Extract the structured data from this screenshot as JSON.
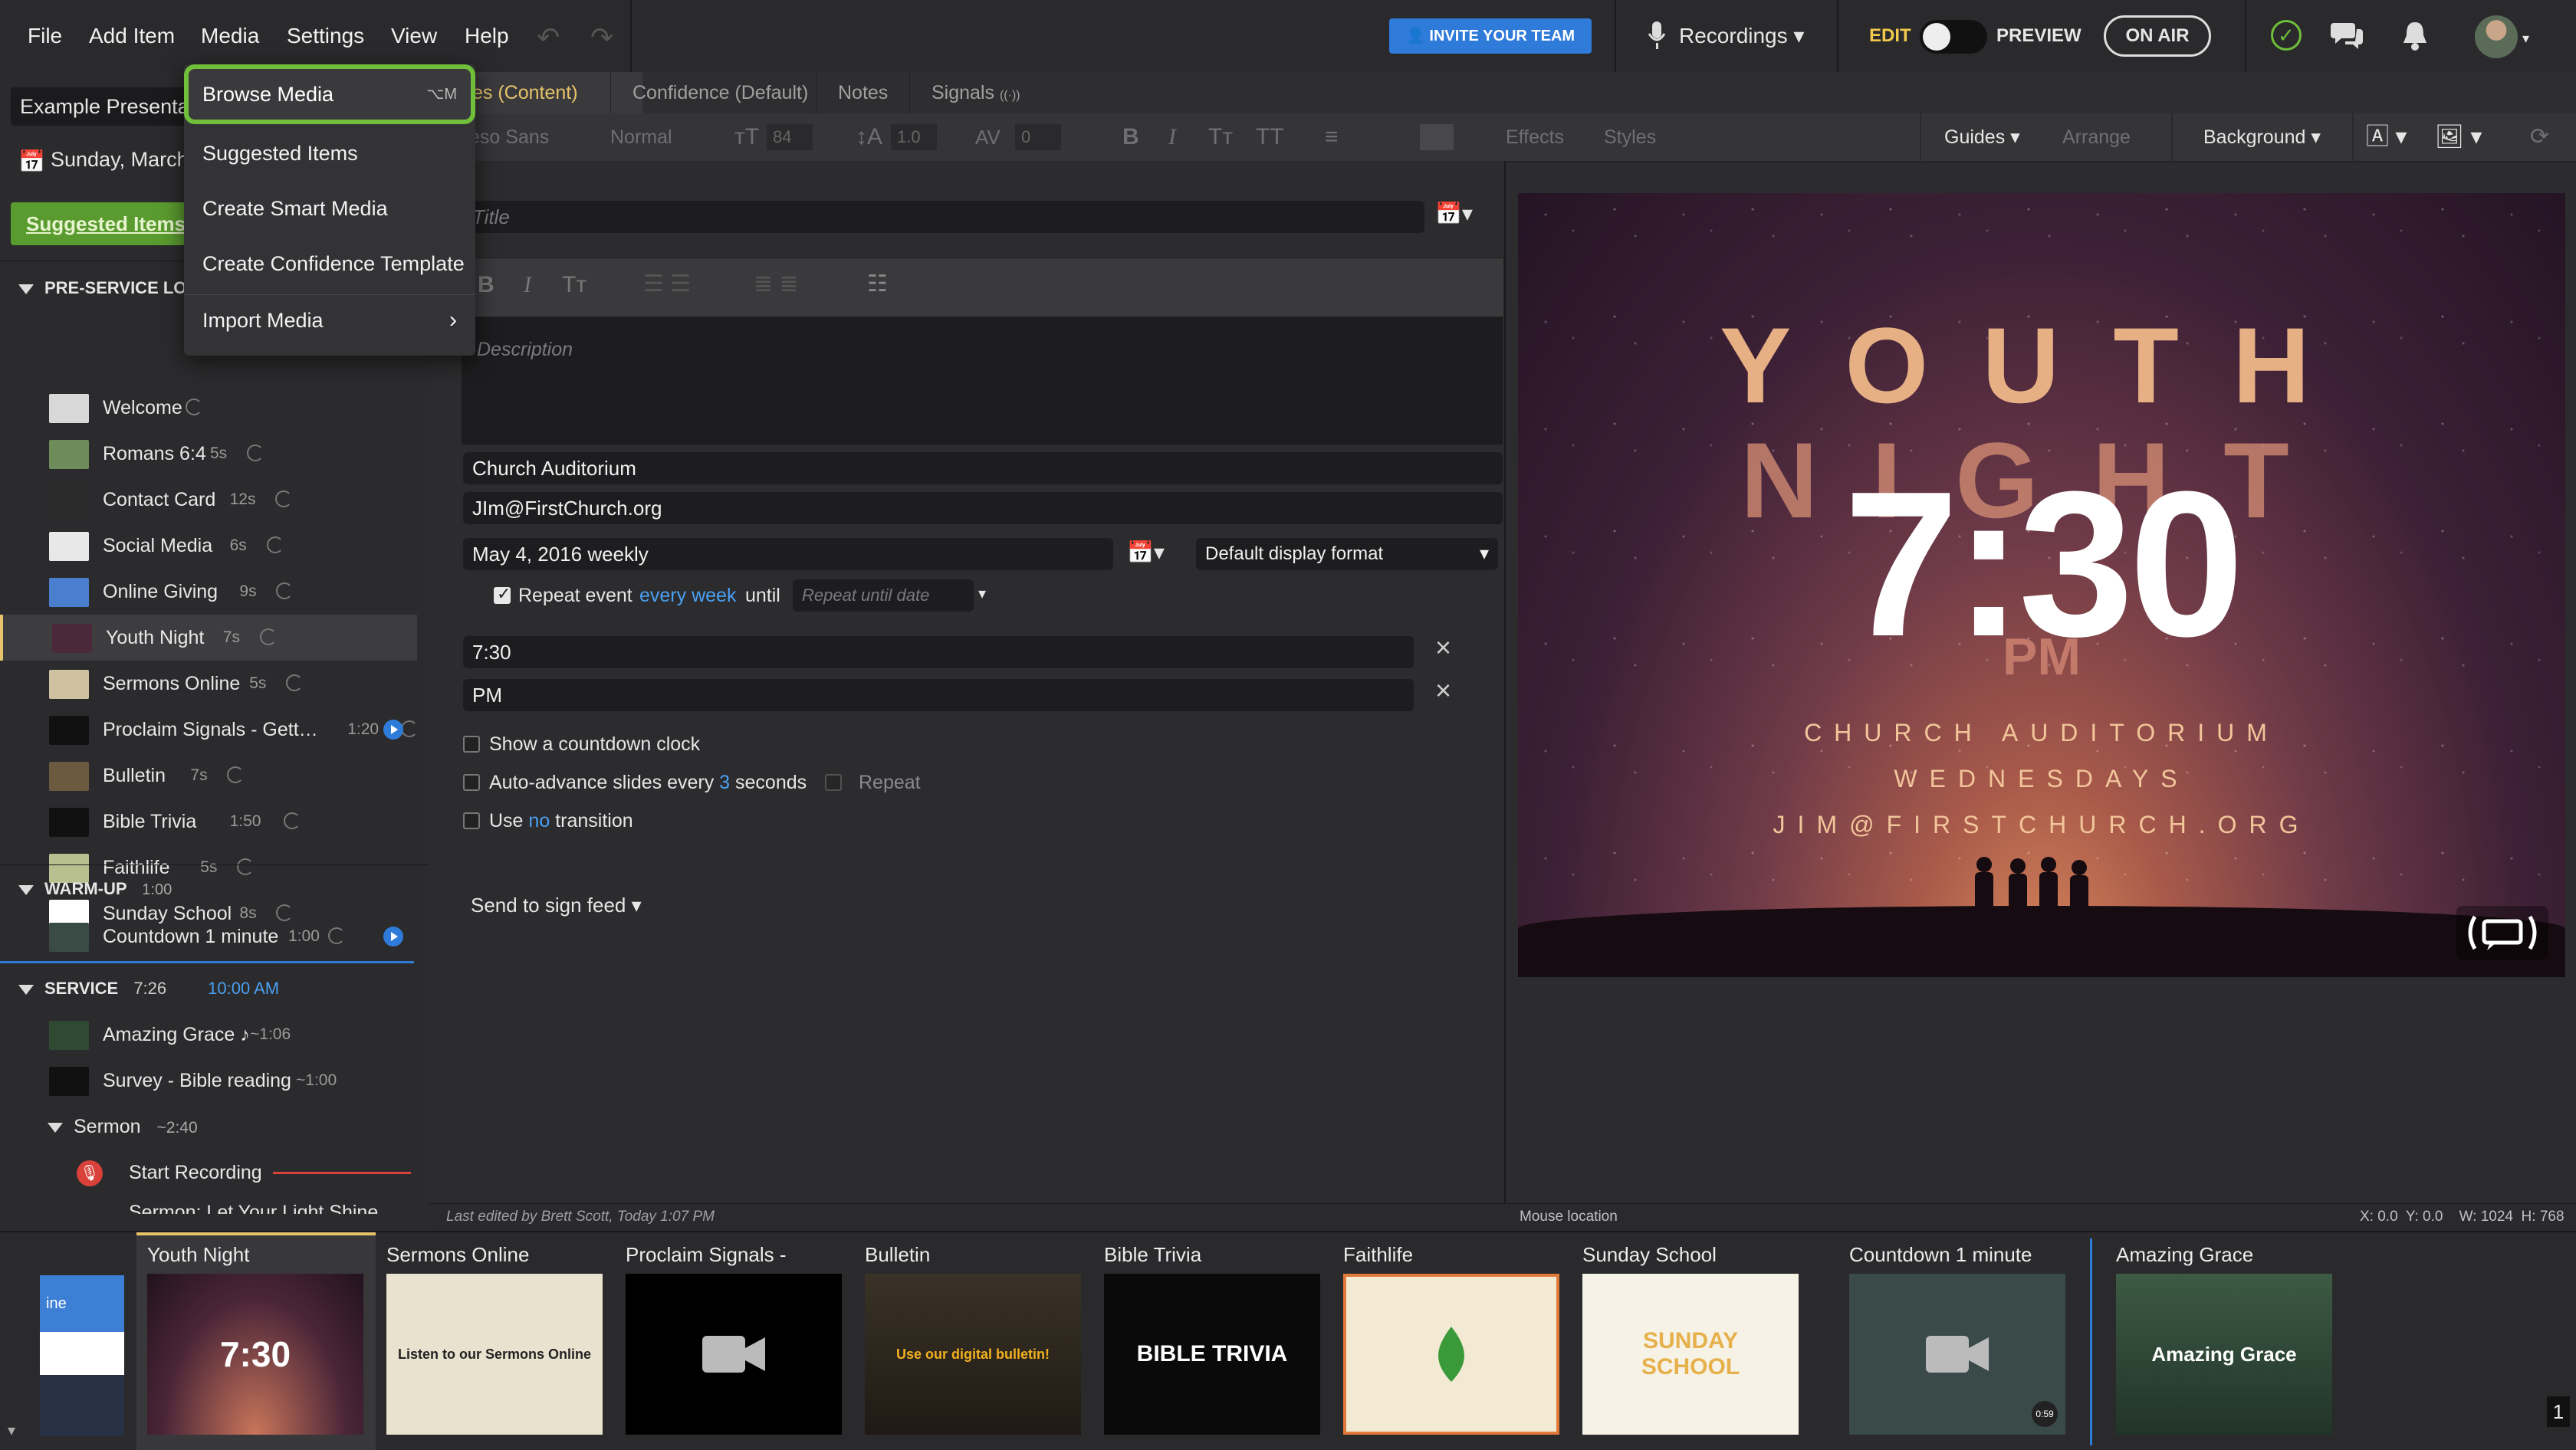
{
  "menubar": {
    "items": [
      "File",
      "Add Item",
      "Media",
      "Settings",
      "View",
      "Help"
    ],
    "invite_label": "INVITE YOUR TEAM",
    "recordings_label": "Recordings",
    "edit_label": "EDIT",
    "preview_label": "PREVIEW",
    "on_air_label": "ON AIR"
  },
  "media_menu": {
    "items": [
      "Browse Media",
      "Suggested Items",
      "Create Smart Media",
      "Create Confidence Template",
      "Import Media"
    ],
    "browse_shortcut": "⌥M"
  },
  "left": {
    "presentation_title": "Example Presenta",
    "date": "Sunday, March",
    "suggested_button": "Suggested Items",
    "pre_service_label": "PRE-SERVICE LOO",
    "pre_service_items": [
      {
        "name": "Welcome",
        "dur": ""
      },
      {
        "name": "Romans 6:4",
        "dur": "5s"
      },
      {
        "name": "Contact Card",
        "dur": "12s"
      },
      {
        "name": "Social Media",
        "dur": "6s"
      },
      {
        "name": "Online Giving",
        "dur": "9s"
      },
      {
        "name": "Youth Night",
        "dur": "7s"
      },
      {
        "name": "Sermons Online",
        "dur": "5s"
      },
      {
        "name": "Proclaim Signals - Gett…",
        "dur": "1:20"
      },
      {
        "name": "Bulletin",
        "dur": "7s"
      },
      {
        "name": "Bible Trivia",
        "dur": "1:50"
      },
      {
        "name": "Faithlife",
        "dur": "5s"
      },
      {
        "name": "Sunday School",
        "dur": "8s"
      }
    ],
    "warmup_label": "WARM-UP",
    "warmup_dur": "1:00",
    "warmup_item": {
      "name": "Countdown 1 minute",
      "dur": "1:00"
    },
    "service_label": "SERVICE",
    "service_dur": "7:26",
    "service_time": "10:00 AM",
    "service_items": [
      {
        "name": "Amazing Grace ♪",
        "dur": "~1:06"
      },
      {
        "name": "Survey - Bible reading",
        "dur": "~1:00"
      }
    ],
    "sermon_label": "Sermon",
    "sermon_dur": "~2:40",
    "start_recording": "Start Recording",
    "cut_item": "Sermon: Let Your Light Shine"
  },
  "tabs": [
    "es (Content)",
    "Confidence (Default)",
    "Notes",
    "Signals"
  ],
  "format_bar": {
    "font": "eso Sans",
    "weight": "Normal",
    "size": "84",
    "line": "1.0",
    "spacing": "0",
    "effects": "Effects",
    "styles": "Styles",
    "guides": "Guides",
    "arrange": "Arrange",
    "background": "Background"
  },
  "editor": {
    "title_placeholder": "Title",
    "description_placeholder": "Description",
    "location": "Church Auditorium",
    "email": "JIm@FirstChurch.org",
    "date_text": "May 4, 2016 weekly",
    "display_format": "Default display format",
    "repeat_label": "Repeat event",
    "repeat_freq": "every week",
    "until_label": "until",
    "repeat_until_placeholder": "Repeat until date",
    "time": "7:30",
    "ampm": "PM",
    "countdown_label_a": "Show a",
    "countdown_label_b": "countdown clock",
    "autoadvance_a": "Auto-advance slides every",
    "autoadvance_n": "3",
    "autoadvance_b": "seconds",
    "repeat_label2": "Repeat",
    "use_label": "Use",
    "use_no": "no",
    "transition_label": "transition",
    "send_sign_feed": "Send to sign feed",
    "last_edited": "Last edited by Brett Scott, Today 1:07 PM"
  },
  "preview": {
    "line1": "YOUTH",
    "line2": "NIGHT",
    "time": "7:30",
    "pm": "PM",
    "venue": "CHURCH AUDITORIUM",
    "day": "WEDNESDAYS",
    "email": "JIM@FIRSTCHURCH.ORG",
    "mouse_location": "Mouse location",
    "coords": "X: 0.0  Y: 0.0    W: 1024  H: 768"
  },
  "strip": {
    "cards": [
      {
        "title": "Youth Night",
        "thumb_text": "7:30"
      },
      {
        "title": "Sermons Online",
        "thumb_text": "Listen to our Sermons Online"
      },
      {
        "title": "Proclaim Signals -",
        "thumb_text": ""
      },
      {
        "title": "Bulletin",
        "thumb_text": "Use our digital bulletin!"
      },
      {
        "title": "Bible Trivia",
        "thumb_text": "BIBLE TRIVIA"
      },
      {
        "title": "Faithlife",
        "thumb_text": ""
      },
      {
        "title": "Sunday School",
        "thumb_text": "SUNDAY SCHOOL"
      },
      {
        "title": "Countdown 1 minute",
        "thumb_text": "0:59"
      },
      {
        "title": "Amazing Grace",
        "thumb_text": "Amazing Grace"
      }
    ],
    "page_num": "1"
  },
  "colors": {
    "accent_green": "#6fbf3a",
    "gold": "#e7c36a",
    "blue": "#2f7bd9"
  }
}
